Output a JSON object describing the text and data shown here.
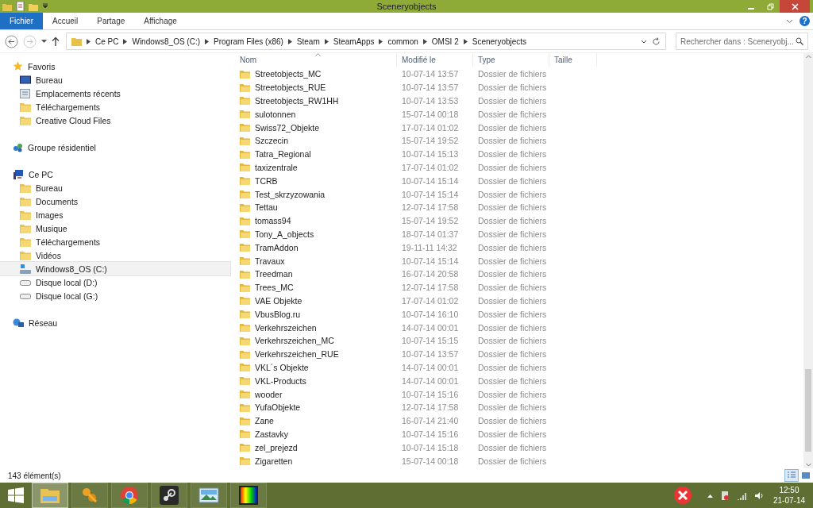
{
  "window": {
    "title": "Sceneryobjects"
  },
  "ribbon": {
    "tabs": [
      {
        "label": "Fichier",
        "selected": true
      },
      {
        "label": "Accueil",
        "selected": false
      },
      {
        "label": "Partage",
        "selected": false
      },
      {
        "label": "Affichage",
        "selected": false
      }
    ],
    "help": "?"
  },
  "address": {
    "crumbs": [
      "Ce PC",
      "Windows8_OS (C:)",
      "Program Files (x86)",
      "Steam",
      "SteamApps",
      "common",
      "OMSI 2",
      "Sceneryobjects"
    ]
  },
  "search": {
    "placeholder": "Rechercher dans : Sceneryobj..."
  },
  "sidebar": {
    "groups": [
      {
        "label": "Favoris",
        "kind": "star",
        "children": [
          {
            "label": "Bureau",
            "kind": "desktop",
            "selected": false
          },
          {
            "label": "Emplacements récents",
            "kind": "recent",
            "selected": false
          },
          {
            "label": "Téléchargements",
            "kind": "folder",
            "selected": false
          },
          {
            "label": "Creative Cloud Files",
            "kind": "folder",
            "selected": false
          }
        ]
      },
      {
        "label": "Groupe résidentiel",
        "kind": "homegroup"
      },
      {
        "label": "Ce PC",
        "kind": "pc",
        "children": [
          {
            "label": "Bureau",
            "kind": "folder",
            "selected": false
          },
          {
            "label": "Documents",
            "kind": "folder",
            "selected": false
          },
          {
            "label": "Images",
            "kind": "folder",
            "selected": false
          },
          {
            "label": "Musique",
            "kind": "folder",
            "selected": false
          },
          {
            "label": "Téléchargements",
            "kind": "folder",
            "selected": false
          },
          {
            "label": "Vidéos",
            "kind": "folder",
            "selected": false
          },
          {
            "label": "Windows8_OS (C:)",
            "kind": "system-drive",
            "selected": true
          },
          {
            "label": "Disque local (D:)",
            "kind": "drive",
            "selected": false
          },
          {
            "label": "Disque local (G:)",
            "kind": "drive",
            "selected": false
          }
        ]
      },
      {
        "label": "Réseau",
        "kind": "network"
      }
    ]
  },
  "table": {
    "columns": [
      "Nom",
      "Modifié le",
      "Type",
      "Taille"
    ],
    "rows": [
      {
        "name": "Streetobjects_MC",
        "modified": "10-07-14 13:57",
        "type": "Dossier de fichiers"
      },
      {
        "name": "Streetobjects_RUE",
        "modified": "10-07-14 13:57",
        "type": "Dossier de fichiers"
      },
      {
        "name": "Streetobjects_RW1HH",
        "modified": "10-07-14 13:53",
        "type": "Dossier de fichiers"
      },
      {
        "name": "sulotonnen",
        "modified": "15-07-14 00:18",
        "type": "Dossier de fichiers"
      },
      {
        "name": "Swiss72_Objekte",
        "modified": "17-07-14 01:02",
        "type": "Dossier de fichiers"
      },
      {
        "name": "Szczecin",
        "modified": "15-07-14 19:52",
        "type": "Dossier de fichiers"
      },
      {
        "name": "Tatra_Regional",
        "modified": "10-07-14 15:13",
        "type": "Dossier de fichiers"
      },
      {
        "name": "taxizentrale",
        "modified": "17-07-14 01:02",
        "type": "Dossier de fichiers"
      },
      {
        "name": "TCRB",
        "modified": "10-07-14 15:14",
        "type": "Dossier de fichiers"
      },
      {
        "name": "Test_skrzyzowania",
        "modified": "10-07-14 15:14",
        "type": "Dossier de fichiers"
      },
      {
        "name": "Tettau",
        "modified": "12-07-14 17:58",
        "type": "Dossier de fichiers"
      },
      {
        "name": "tomass94",
        "modified": "15-07-14 19:52",
        "type": "Dossier de fichiers"
      },
      {
        "name": "Tony_A_objects",
        "modified": "18-07-14 01:37",
        "type": "Dossier de fichiers"
      },
      {
        "name": "TramAddon",
        "modified": "19-11-11 14:32",
        "type": "Dossier de fichiers"
      },
      {
        "name": "Travaux",
        "modified": "10-07-14 15:14",
        "type": "Dossier de fichiers"
      },
      {
        "name": "Treedman",
        "modified": "16-07-14 20:58",
        "type": "Dossier de fichiers"
      },
      {
        "name": "Trees_MC",
        "modified": "12-07-14 17:58",
        "type": "Dossier de fichiers"
      },
      {
        "name": "VAE Objekte",
        "modified": "17-07-14 01:02",
        "type": "Dossier de fichiers"
      },
      {
        "name": "VbusBlog.ru",
        "modified": "10-07-14 16:10",
        "type": "Dossier de fichiers"
      },
      {
        "name": "Verkehrszeichen",
        "modified": "14-07-14 00:01",
        "type": "Dossier de fichiers"
      },
      {
        "name": "Verkehrszeichen_MC",
        "modified": "10-07-14 15:15",
        "type": "Dossier de fichiers"
      },
      {
        "name": "Verkehrszeichen_RUE",
        "modified": "10-07-14 13:57",
        "type": "Dossier de fichiers"
      },
      {
        "name": "VKL´s Objekte",
        "modified": "14-07-14 00:01",
        "type": "Dossier de fichiers"
      },
      {
        "name": "VKL-Products",
        "modified": "14-07-14 00:01",
        "type": "Dossier de fichiers"
      },
      {
        "name": "wooder",
        "modified": "10-07-14 15:16",
        "type": "Dossier de fichiers"
      },
      {
        "name": "YufaObjekte",
        "modified": "12-07-14 17:58",
        "type": "Dossier de fichiers"
      },
      {
        "name": "Zane",
        "modified": "16-07-14 21:40",
        "type": "Dossier de fichiers"
      },
      {
        "name": "Zastavky",
        "modified": "10-07-14 15:16",
        "type": "Dossier de fichiers"
      },
      {
        "name": "zel_prejezd",
        "modified": "10-07-14 15:18",
        "type": "Dossier de fichiers"
      },
      {
        "name": "Zigaretten",
        "modified": "15-07-14 00:18",
        "type": "Dossier de fichiers"
      }
    ]
  },
  "status_bar": {
    "count": "143 élément(s)"
  },
  "taskbar": {
    "apps": [
      {
        "kind": "explorer",
        "selected": true
      },
      {
        "kind": "keys",
        "selected": false
      },
      {
        "kind": "browser",
        "selected": false
      },
      {
        "kind": "steam",
        "selected": false
      },
      {
        "kind": "photos",
        "selected": false
      },
      {
        "kind": "colors",
        "selected": false
      }
    ],
    "time": "12:50",
    "date": "21-07-14"
  }
}
